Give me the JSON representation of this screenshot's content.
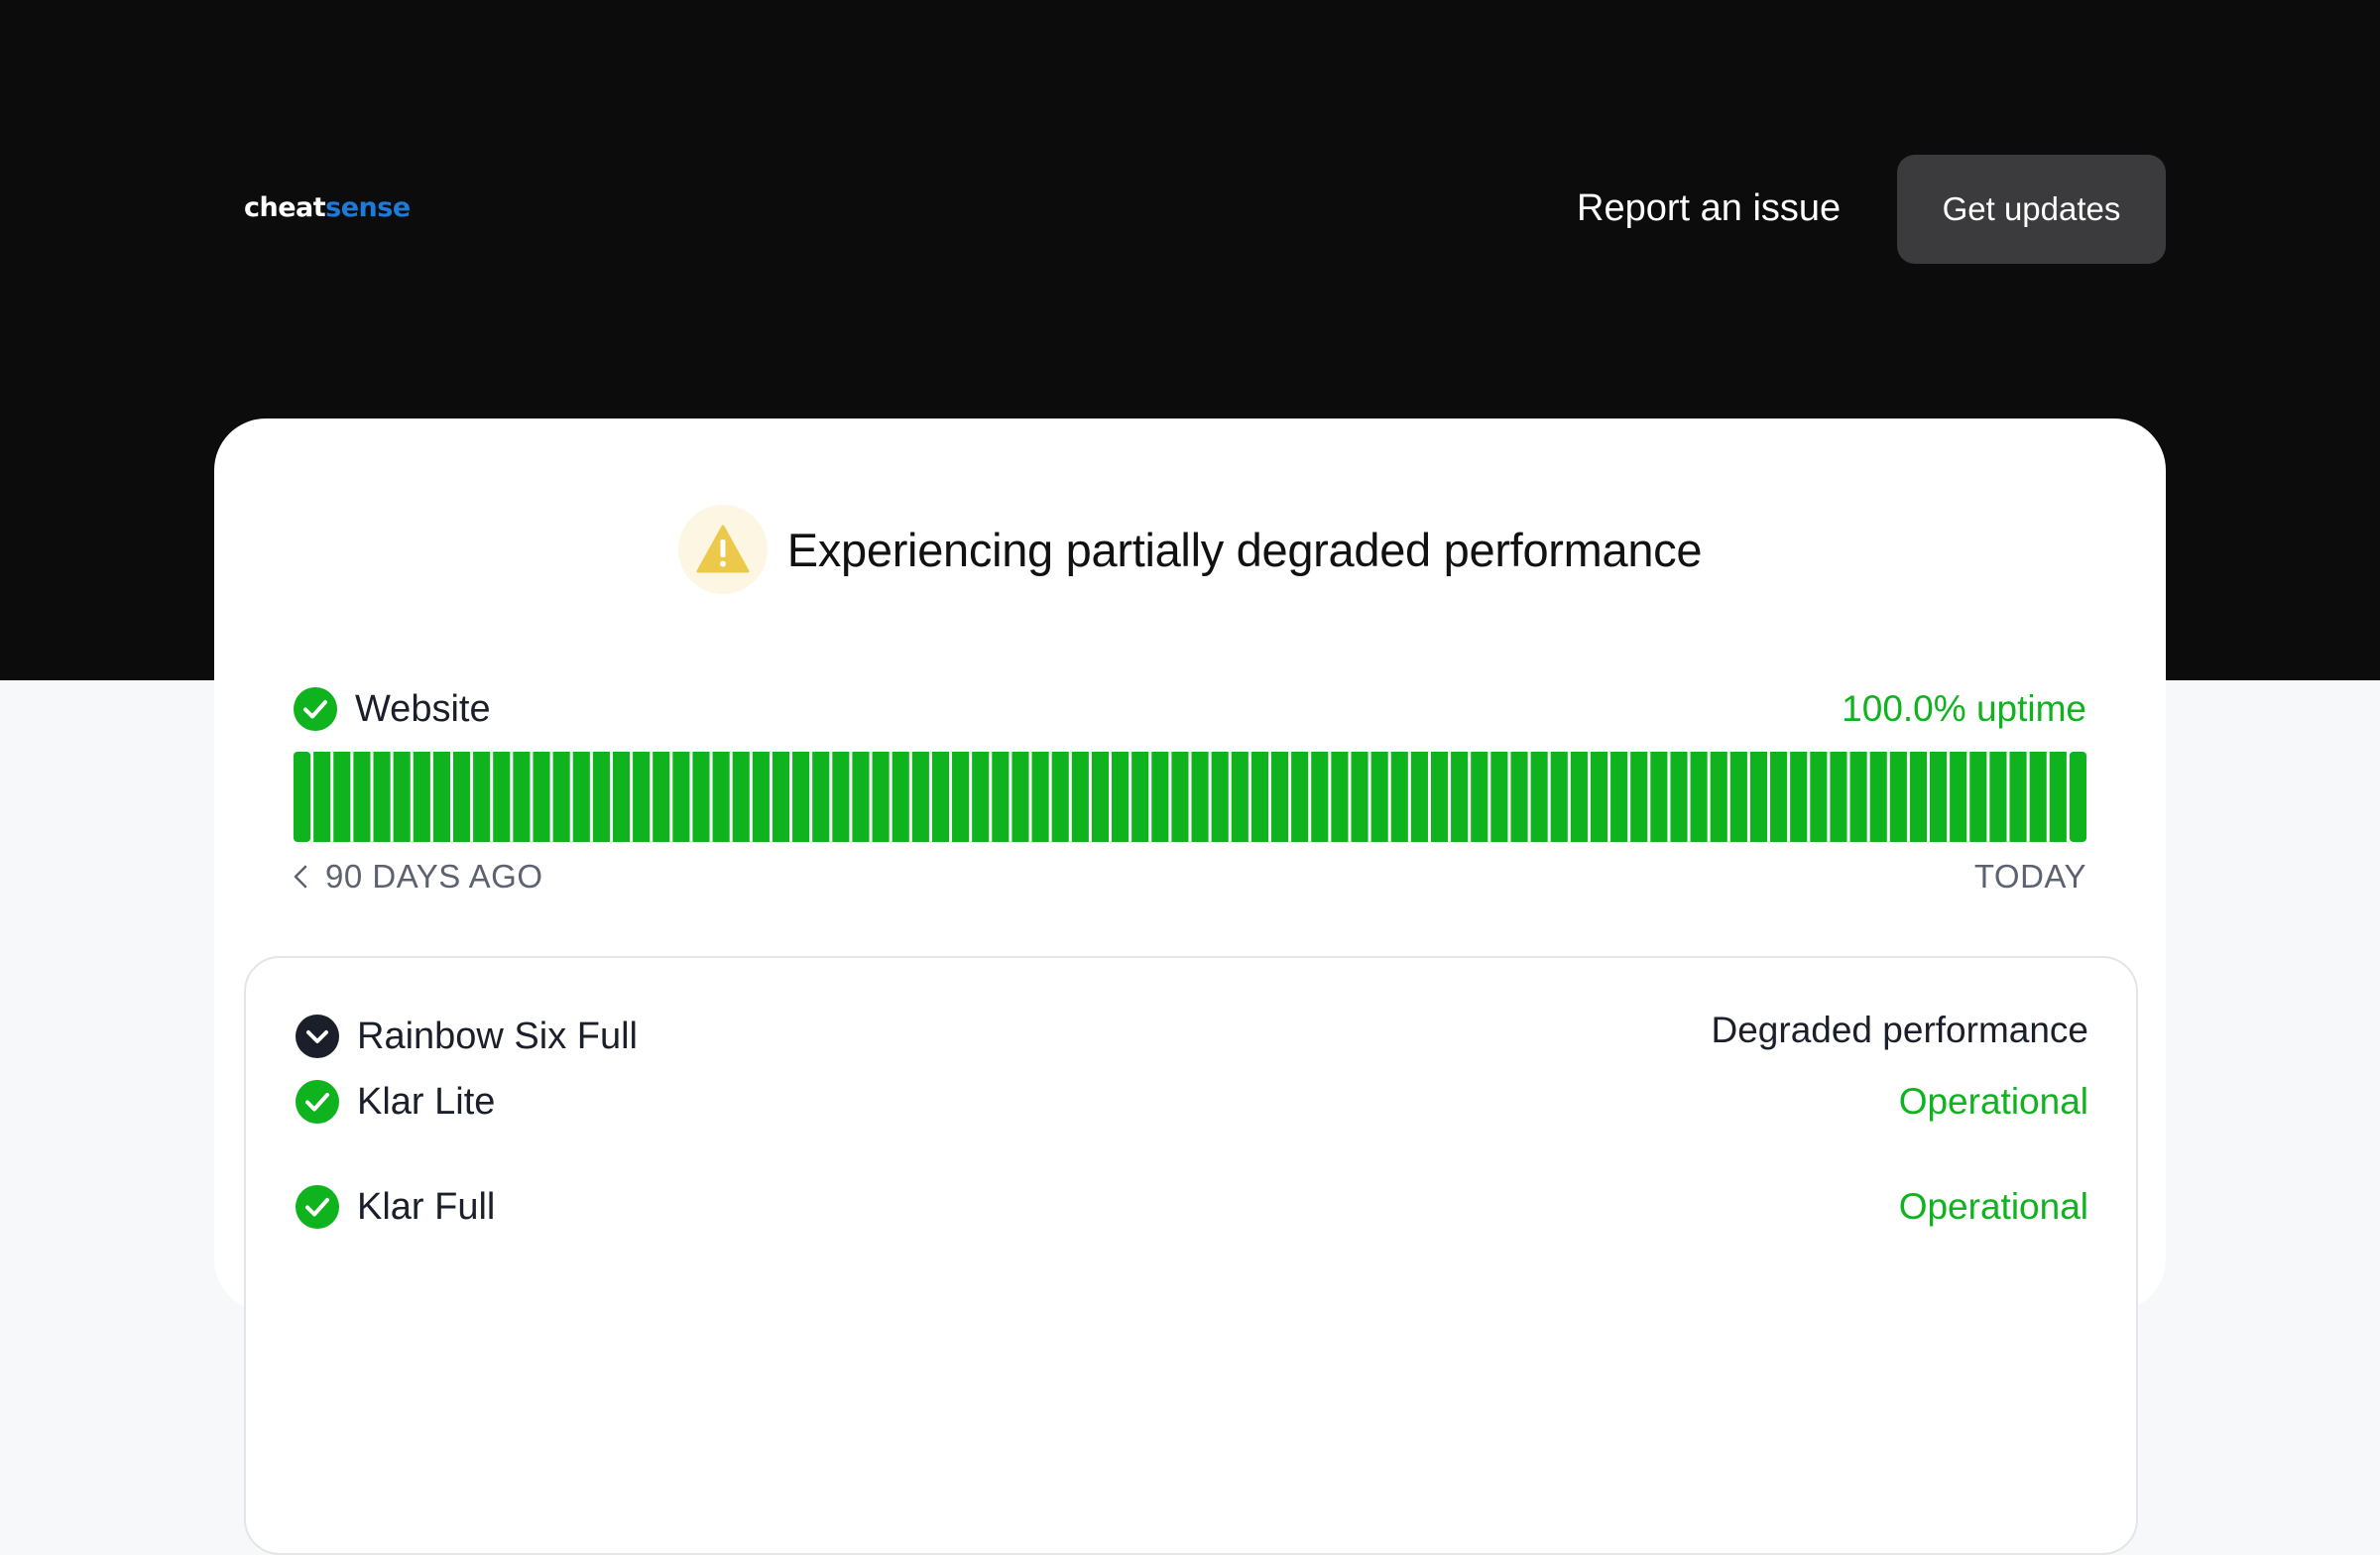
{
  "header": {
    "logo_part1": "cheat",
    "logo_part2": "sense",
    "report_link": "Report an issue",
    "updates_button": "Get updates"
  },
  "status": {
    "icon": "warning-triangle-icon",
    "title": "Experiencing partially degraded performance"
  },
  "service": {
    "name": "Website",
    "uptime": "100.0% uptime",
    "days": 90,
    "range_start": "90 DAYS AGO",
    "range_end": "TODAY"
  },
  "group": {
    "name": "Rainbow Six Full",
    "status": "Degraded performance",
    "items": [
      {
        "name": "Klar Lite",
        "status": "Operational"
      },
      {
        "name": "Klar Full",
        "status": "Operational"
      }
    ]
  },
  "colors": {
    "operational": "#0fb31d",
    "warning": "#ecc94b",
    "dark": "#1b1f2a",
    "brand_accent": "#1d7ad9"
  }
}
